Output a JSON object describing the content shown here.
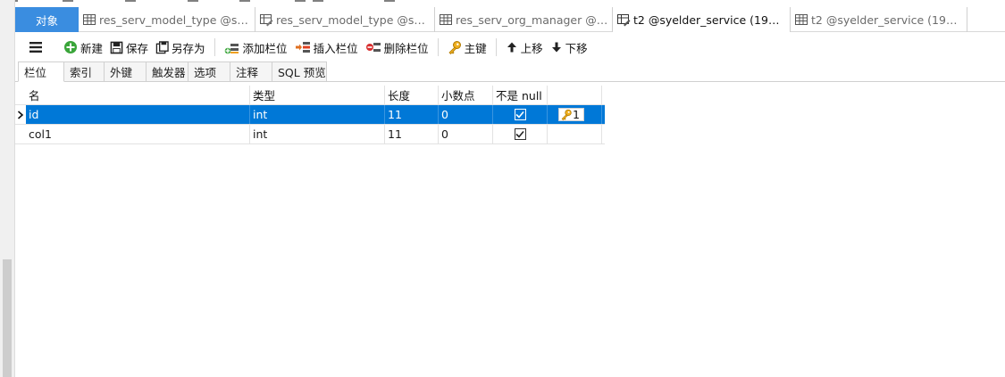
{
  "doc_tabs": [
    {
      "label": "对象",
      "icon": "none"
    },
    {
      "label": "res_serv_model_type @syel...",
      "icon": "table-icon"
    },
    {
      "label": "res_serv_model_type @syel...",
      "icon": "table-design-icon"
    },
    {
      "label": "res_serv_org_manager @sy...",
      "icon": "table-icon"
    },
    {
      "label": "t2 @syelder_service (192.16...",
      "icon": "table-design-icon"
    },
    {
      "label": "t2 @syelder_service (192.16...",
      "icon": "table-icon"
    }
  ],
  "toolbar": {
    "new": "新建",
    "save": "保存",
    "save_as": "另存为",
    "add_field": "添加栏位",
    "insert_field": "插入栏位",
    "delete_field": "删除栏位",
    "primary_key": "主键",
    "move_up": "上移",
    "move_down": "下移"
  },
  "sub_tabs": [
    "栏位",
    "索引",
    "外键",
    "触发器",
    "选项",
    "注释",
    "SQL 预览"
  ],
  "columns": {
    "name": "名",
    "type": "类型",
    "length": "长度",
    "decimals": "小数点",
    "not_null": "不是 null",
    "key": ""
  },
  "rows": [
    {
      "name": "id",
      "type": "int",
      "length": "11",
      "decimals": "0",
      "not_null": true,
      "key": "1"
    },
    {
      "name": "col1",
      "type": "int",
      "length": "11",
      "decimals": "0",
      "not_null": true,
      "key": ""
    }
  ],
  "colors": {
    "accent": "#0078d7",
    "objects_tab": "#3a8de0"
  }
}
